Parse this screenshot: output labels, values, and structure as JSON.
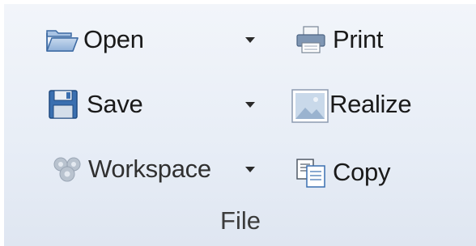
{
  "group": {
    "label": "File"
  },
  "commands": {
    "open": {
      "label": "Open",
      "icon": "folder-open-icon",
      "has_dropdown": true
    },
    "save": {
      "label": "Save",
      "icon": "floppy-disk-icon",
      "has_dropdown": true
    },
    "workspace": {
      "label": "Workspace",
      "icon": "workspace-gears-icon",
      "has_dropdown": true,
      "enabled": false
    },
    "print": {
      "label": "Print",
      "icon": "printer-icon"
    },
    "realize": {
      "label": "Realize",
      "icon": "image-icon"
    },
    "copy": {
      "label": "Copy",
      "icon": "copy-icon"
    }
  },
  "colors": {
    "background_top": "#f2f5fa",
    "background_bottom": "#dfe6f1",
    "text": "#1a1a1a",
    "icon_blue": "#3a6fb0"
  }
}
